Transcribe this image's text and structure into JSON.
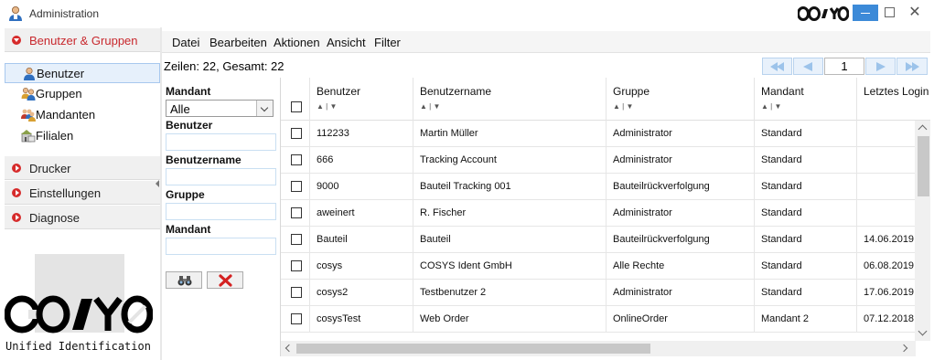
{
  "window": {
    "title": "Administration",
    "brand_logo": "cosys-logo",
    "controls": {
      "minimize": "minimize-icon",
      "maximize": "maximize-icon",
      "close": "✕"
    }
  },
  "sidebar": {
    "groups": [
      {
        "label": "Benutzer & Gruppen",
        "active": true
      },
      {
        "label": "Drucker"
      },
      {
        "label": "Einstellungen"
      },
      {
        "label": "Diagnose"
      }
    ],
    "items": [
      {
        "label": "Benutzer",
        "icon": "user-icon",
        "selected": true
      },
      {
        "label": "Gruppen",
        "icon": "group-icon"
      },
      {
        "label": "Mandanten",
        "icon": "clients-icon"
      },
      {
        "label": "Filialen",
        "icon": "branches-icon"
      }
    ],
    "logo_tagline": "Unified Identification"
  },
  "menu": [
    "Datei",
    "Bearbeiten",
    "Aktionen",
    "Ansicht",
    "Filter"
  ],
  "rows_info": "Zeilen: 22, Gesamt: 22",
  "pager": {
    "page": "1"
  },
  "filter": {
    "mandant_label": "Mandant",
    "mandant_value": "Alle",
    "benutzer_label": "Benutzer",
    "benutzername_label": "Benutzername",
    "gruppe_label": "Gruppe",
    "mandant2_label": "Mandant",
    "search_icon": "binoculars-icon",
    "clear_icon": "red-x-icon"
  },
  "colors": {
    "accent": "#c8282d",
    "selection": "#e6f0fb",
    "window_button": "#3c8ad8"
  },
  "table": {
    "columns": [
      "Benutzer",
      "Benutzername",
      "Gruppe",
      "Mandant",
      "Letztes Login"
    ],
    "sort_hint": "▲ | ▼",
    "rows": [
      [
        "112233",
        "Martin Müller",
        "Administrator",
        "Standard",
        ""
      ],
      [
        "666",
        "Tracking Account",
        "Administrator",
        "Standard",
        ""
      ],
      [
        "9000",
        "Bauteil Tracking 001",
        "Bauteilrückverfolgung",
        "Standard",
        ""
      ],
      [
        "aweinert",
        "R. Fischer",
        "Administrator",
        "Standard",
        ""
      ],
      [
        "Bauteil",
        "Bauteil",
        "Bauteilrückverfolgung",
        "Standard",
        "14.06.2019"
      ],
      [
        "cosys",
        "COSYS Ident GmbH",
        "Alle Rechte",
        "Standard",
        "06.08.2019"
      ],
      [
        "cosys2",
        "Testbenutzer 2",
        "Administrator",
        "Standard",
        "17.06.2019"
      ],
      [
        "cosysTest",
        "Web Order",
        "OnlineOrder",
        "Mandant 2",
        "07.12.2018"
      ]
    ]
  }
}
